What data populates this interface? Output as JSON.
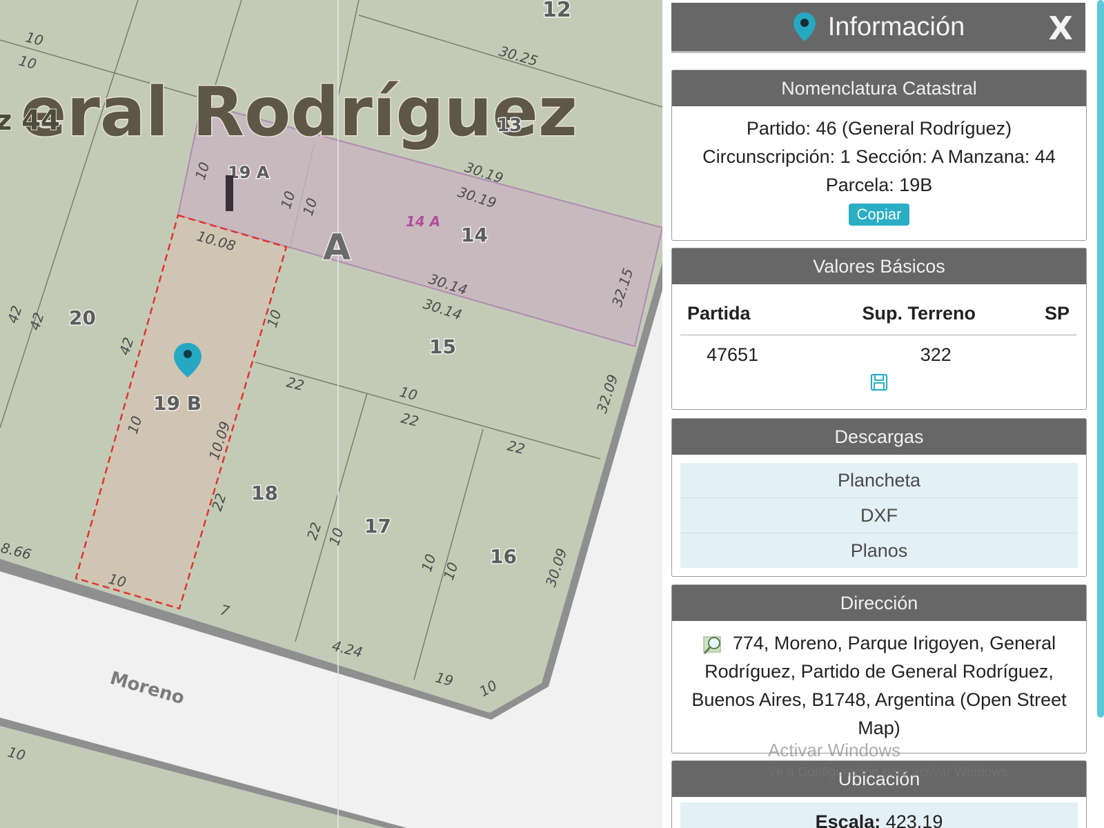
{
  "map": {
    "city_label": "eral Rodríguez",
    "block_label_partial": "z 44",
    "street_name": "Moreno",
    "section_letter": "A",
    "highlighted_parcel": "19 B",
    "parcels": [
      "12",
      "13",
      "14",
      "14 A",
      "15",
      "16",
      "17",
      "18",
      "19 A",
      "19 B",
      "20"
    ],
    "dimensions": [
      "10",
      "10",
      "30.25",
      "30.19",
      "30.19",
      "10.08",
      "30.14",
      "30.14",
      "42",
      "42",
      "42",
      "10",
      "10",
      "10",
      "10",
      "32.15",
      "32.09",
      "30.09",
      "10",
      "10.09",
      "10",
      "22",
      "22",
      "22",
      "22",
      "22",
      "10",
      "10",
      "10",
      "10",
      "7",
      "4.24",
      "19",
      "10",
      "8.66",
      "10"
    ],
    "colors": {
      "background": "#c3cbb7",
      "highlight_fill": "#d0c5b3",
      "highlight_border": "#e0342f",
      "section_fill": "#c9b4c0",
      "pin": "#26a8c3"
    }
  },
  "panel": {
    "title": "Información",
    "title_icon": "location-pin-icon",
    "close_label": "X",
    "nomenclatura": {
      "header": "Nomenclatura Catastral",
      "line1": "Partido: 46 (General Rodríguez)",
      "line2": "Circunscripción: 1 Sección: A Manzana: 44",
      "line3": "Parcela: 19B",
      "copy_button": "Copiar"
    },
    "valores": {
      "header": "Valores Básicos",
      "columns": [
        "Partida",
        "Sup. Terreno",
        "SP"
      ],
      "rows": [
        [
          "47651",
          "322",
          ""
        ]
      ],
      "save_icon": "save-icon"
    },
    "descargas": {
      "header": "Descargas",
      "items": [
        "Plancheta",
        "DXF",
        "Planos"
      ]
    },
    "direccion": {
      "header": "Dirección",
      "address": "774, Moreno, Parque Irigoyen, General Rodríguez, Partido de General Rodríguez, Buenos Aires, B1748, Argentina (Open Street Map)",
      "icon": "map-search-icon"
    },
    "ubicacion": {
      "header": "Ubicación",
      "scale_label": "Escala:",
      "scale_value": "423.19"
    },
    "watermark": {
      "line1": "Activar Windows",
      "line2": "Ve a Configuración para activar Windows."
    },
    "colors": {
      "header_bg": "#676767",
      "accent": "#2aaec4",
      "download_bg": "#e3f0f5"
    }
  }
}
